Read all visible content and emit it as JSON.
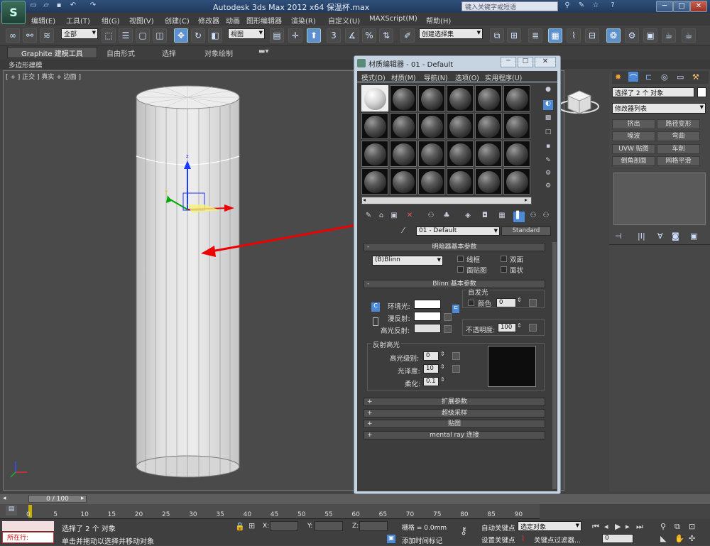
{
  "titlebar": {
    "app_title": "Autodesk 3ds Max  2012 x64      保温杯.max",
    "search_placeholder": "键入关键字或短语"
  },
  "menubar": [
    "编辑(E)",
    "工具(T)",
    "组(G)",
    "视图(V)",
    "创建(C)",
    "修改器",
    "动画",
    "图形编辑器",
    "渲染(R)",
    "自定义(U)",
    "MAXScript(M)",
    "帮助(H)"
  ],
  "toolbar": {
    "selection_filter": "全部",
    "ref_coord": "视图",
    "named_selection": "创建选择集"
  },
  "ribbon": {
    "tabs": [
      "Graphite 建模工具",
      "自由形式",
      "选择",
      "对象绘制"
    ],
    "subtab": "多边形建模"
  },
  "viewport": {
    "label": "[ + ] 正交 ] 真实 + 边面 ]"
  },
  "material_editor": {
    "title": "材质编辑器 - 01 - Default",
    "menu": [
      "模式(D)",
      "材质(M)",
      "导航(N)",
      "选项(O)",
      "实用程序(U)"
    ],
    "material_name": "01 - Default",
    "material_type": "Standard",
    "shader_rollout": "明暗器基本参数",
    "shader": "(B)Blinn",
    "checkboxes": [
      "线框",
      "双面",
      "面贴图",
      "面状"
    ],
    "blinn_rollout": "Blinn 基本参数",
    "self_illum": "自发光",
    "color_label": "颜色",
    "color_value": "0",
    "ambient": "环境光:",
    "diffuse": "漫反射:",
    "specular": "高光反射:",
    "opacity_label": "不透明度:",
    "opacity_value": "100",
    "spec_highlights": "反射高光",
    "spec_level_label": "高光级别:",
    "spec_level": "0",
    "gloss_label": "光泽度:",
    "gloss": "10",
    "soften_label": "柔化:",
    "soften": "0.1",
    "rollouts": [
      "扩展参数",
      "超级采样",
      "贴图",
      "mental ray 连接"
    ]
  },
  "command_panel": {
    "selection_text": "选择了 2 个 对象",
    "modifier_list": "修改器列表",
    "buttons": [
      "挤出",
      "路径变形",
      "噪波",
      "弯曲",
      "UVW 贴图",
      "车削",
      "倒角剖面",
      "网格平滑"
    ]
  },
  "timeline": {
    "frame": "0 / 100",
    "ticks": [
      "0",
      "5",
      "10",
      "15",
      "20",
      "25",
      "30",
      "35",
      "40",
      "45",
      "50",
      "55",
      "60",
      "65",
      "70",
      "75",
      "80",
      "85",
      "90"
    ]
  },
  "status": {
    "selected": "选择了 2 个 对象",
    "prompt": "单击并拖动以选择并移动对象",
    "running": "所在行:",
    "x_label": "X:",
    "y_label": "Y:",
    "z_label": "Z:",
    "grid": "栅格 = 0.0mm",
    "add_time_tag": "添加时间标记",
    "auto_key": "自动关键点",
    "set_key": "设置关键点",
    "key_mode": "选定对象",
    "key_filters": "关键点过滤器...",
    "frame_field": "0"
  }
}
